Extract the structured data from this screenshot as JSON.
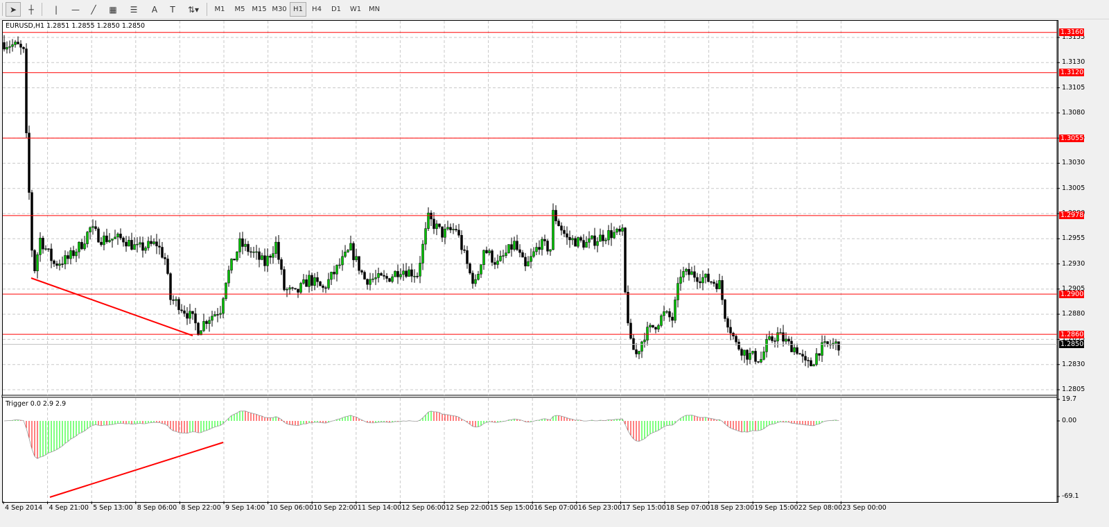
{
  "toolbar": {
    "tools": [
      {
        "name": "cursor-tool",
        "glyph": "➤"
      },
      {
        "name": "crosshair-tool",
        "glyph": "┼"
      },
      {
        "name": "vertical-line-tool",
        "glyph": "|"
      },
      {
        "name": "horizontal-line-tool",
        "glyph": "—"
      },
      {
        "name": "trendline-tool",
        "glyph": "╱"
      },
      {
        "name": "equidistant-channel-tool",
        "glyph": "▦"
      },
      {
        "name": "fibonacci-tool",
        "glyph": "☰"
      },
      {
        "name": "text-tool",
        "glyph": "A"
      },
      {
        "name": "text-label-tool",
        "glyph": "T"
      },
      {
        "name": "arrows-tool",
        "glyph": "⇅▾"
      }
    ],
    "timeframes": [
      "M1",
      "M5",
      "M15",
      "M30",
      "H1",
      "H4",
      "D1",
      "W1",
      "MN"
    ],
    "active_timeframe": "H1"
  },
  "chart": {
    "title": "EURUSD,H1  1.2851 1.2855 1.2850 1.2850",
    "symbol": "EURUSD",
    "timeframe": "H1",
    "open": 1.2851,
    "high": 1.2855,
    "low": 1.285,
    "close": 1.285,
    "price_ticks": [
      "1.3155",
      "1.3130",
      "1.3105",
      "1.3080",
      "1.3055",
      "1.3030",
      "1.3005",
      "1.2980",
      "1.2955",
      "1.2930",
      "1.2905",
      "1.2880",
      "1.2855",
      "1.2830",
      "1.2805"
    ],
    "horizontal_levels": [
      "1.3160",
      "1.3120",
      "1.3055",
      "1.2978",
      "1.2900",
      "1.2860"
    ],
    "current_price": "1.2850",
    "time_labels": [
      "4 Sep 2014",
      "4 Sep 21:00",
      "5 Sep 13:00",
      "8 Sep 06:00",
      "8 Sep 22:00",
      "9 Sep 14:00",
      "10 Sep 06:00",
      "10 Sep 22:00",
      "11 Sep 14:00",
      "12 Sep 06:00",
      "12 Sep 22:00",
      "15 Sep 15:00",
      "16 Sep 07:00",
      "16 Sep 23:00",
      "17 Sep 15:00",
      "18 Sep 07:00",
      "18 Sep 23:00",
      "19 Sep 15:00",
      "22 Sep 08:00",
      "23 Sep 00:00"
    ],
    "colors": {
      "level": "#ff0000",
      "bull": "#00c000",
      "bear": "#000000",
      "current": "#000000"
    }
  },
  "indicator": {
    "title": "Trigger 0.0 2.9 2.9",
    "ticks": [
      "19.7",
      "0.00",
      "-69.1"
    ],
    "colors": {
      "up": "#00ff00",
      "down": "#ff0000"
    }
  },
  "chart_data": {
    "type": "candlestick",
    "ylim": [
      1.279,
      1.317
    ],
    "bars": 302,
    "close_path": [
      [
        0,
        1.315
      ],
      [
        6,
        1.3146
      ],
      [
        8,
        1.314
      ],
      [
        8,
        1.312
      ],
      [
        9,
        1.3055
      ],
      [
        10,
        1.3
      ],
      [
        11,
        1.2945
      ],
      [
        12,
        1.2925
      ],
      [
        14,
        1.2955
      ],
      [
        19,
        1.293
      ],
      [
        24,
        1.2935
      ],
      [
        29,
        1.295
      ],
      [
        32,
        1.2965
      ],
      [
        36,
        1.2955
      ],
      [
        44,
        1.2955
      ],
      [
        49,
        1.2945
      ],
      [
        56,
        1.295
      ],
      [
        59,
        1.2935
      ],
      [
        61,
        1.2895
      ],
      [
        64,
        1.289
      ],
      [
        69,
        1.2875
      ],
      [
        71,
        1.2865
      ],
      [
        74,
        1.2875
      ],
      [
        79,
        1.2885
      ],
      [
        81,
        1.2915
      ],
      [
        86,
        1.295
      ],
      [
        91,
        1.294
      ],
      [
        95,
        1.293
      ],
      [
        99,
        1.295
      ],
      [
        102,
        1.2905
      ],
      [
        106,
        1.29
      ],
      [
        111,
        1.2915
      ],
      [
        116,
        1.2905
      ],
      [
        121,
        1.2925
      ],
      [
        126,
        1.2945
      ],
      [
        131,
        1.2915
      ],
      [
        139,
        1.2915
      ],
      [
        144,
        1.2925
      ],
      [
        150,
        1.292
      ],
      [
        154,
        1.2975
      ],
      [
        159,
        1.296
      ],
      [
        164,
        1.2965
      ],
      [
        169,
        1.292
      ],
      [
        171,
        1.291
      ],
      [
        174,
        1.2945
      ],
      [
        179,
        1.293
      ],
      [
        185,
        1.295
      ],
      [
        189,
        1.2925
      ],
      [
        194,
        1.295
      ],
      [
        198,
        1.2945
      ],
      [
        199,
        1.298
      ],
      [
        204,
        1.2955
      ],
      [
        211,
        1.295
      ],
      [
        219,
        1.296
      ],
      [
        224,
        1.296
      ],
      [
        225,
        1.29
      ],
      [
        227,
        1.285
      ],
      [
        229,
        1.284
      ],
      [
        232,
        1.286
      ],
      [
        236,
        1.287
      ],
      [
        239,
        1.288
      ],
      [
        242,
        1.2875
      ],
      [
        245,
        1.292
      ],
      [
        249,
        1.292
      ],
      [
        254,
        1.2915
      ],
      [
        259,
        1.291
      ],
      [
        261,
        1.288
      ],
      [
        265,
        1.285
      ],
      [
        269,
        1.284
      ],
      [
        274,
        1.2835
      ],
      [
        276,
        1.285
      ],
      [
        280,
        1.286
      ],
      [
        284,
        1.285
      ],
      [
        287,
        1.2845
      ],
      [
        290,
        1.283
      ],
      [
        292,
        1.283
      ],
      [
        295,
        1.2845
      ],
      [
        299,
        1.285
      ],
      [
        302,
        1.285
      ]
    ]
  }
}
